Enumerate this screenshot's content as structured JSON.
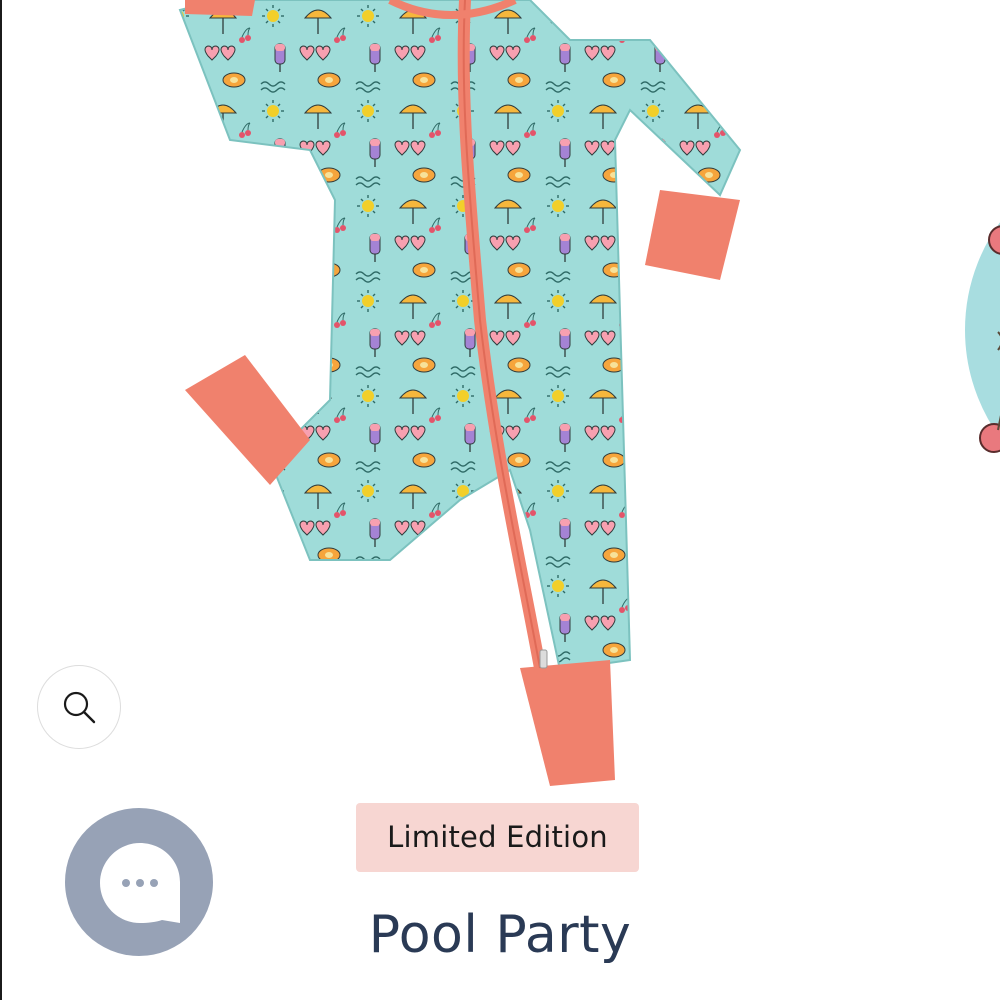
{
  "product": {
    "badge": "Limited Edition",
    "title": "Pool Party",
    "image": "pool-party-zip-romper"
  },
  "controls": {
    "zoom_icon": "search-icon",
    "chat_icon": "chat-bubble-icon"
  },
  "colors": {
    "fabric": "#9fdcd9",
    "trim": "#f0816d",
    "badge_bg": "#f7d6d2",
    "title": "#2a3a55",
    "chat_button": "#97a2b6"
  }
}
